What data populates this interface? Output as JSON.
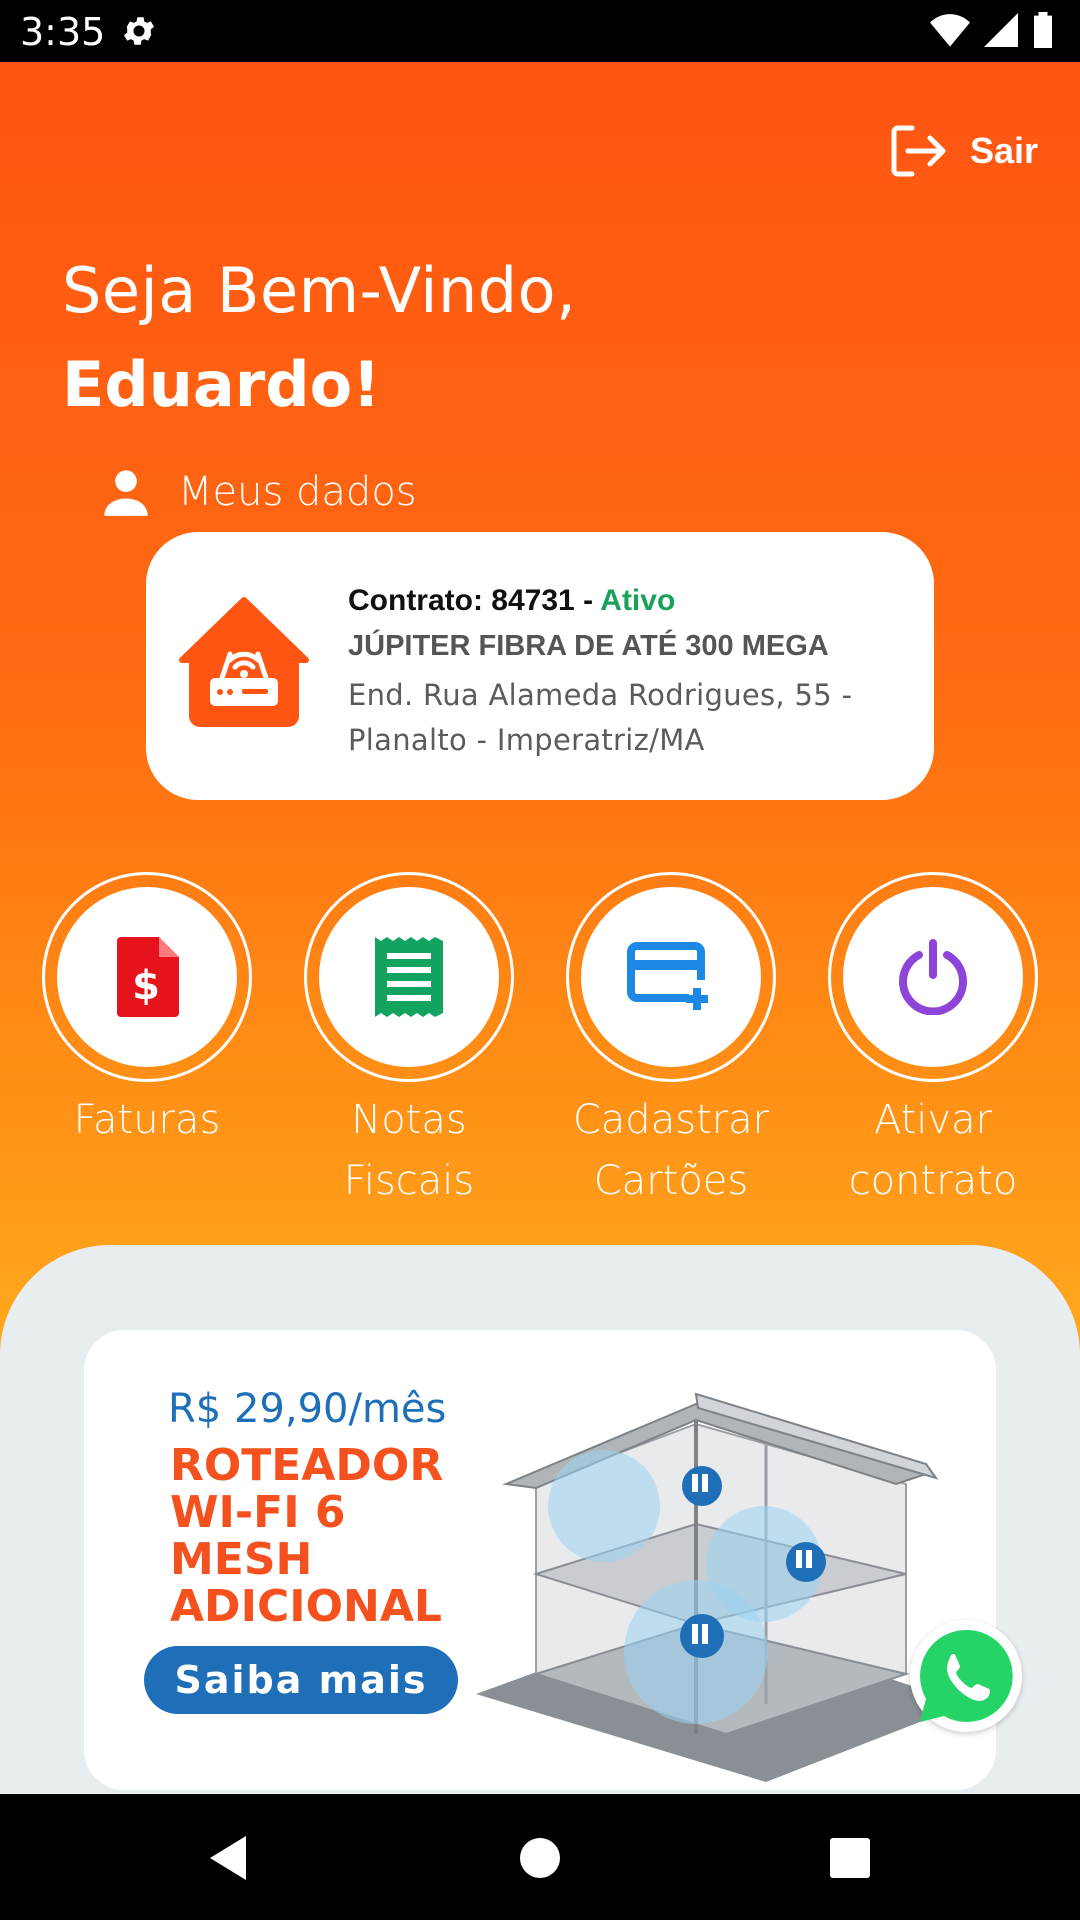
{
  "status_bar": {
    "time": "3:35",
    "icons": [
      "gear-icon",
      "wifi-icon",
      "signal-icon",
      "battery-icon"
    ]
  },
  "header": {
    "logout_label": "Sair",
    "logout_icon": "logout-icon"
  },
  "greeting": {
    "line1": "Seja Bem-Vindo,",
    "name": "Eduardo!"
  },
  "profile_link": {
    "label": "Meus dados",
    "icon": "person-icon"
  },
  "contract": {
    "prefix": "Contrato: 84731 - ",
    "status": "Ativo",
    "plan": "JÚPITER FIBRA DE ATÉ 300 MEGA",
    "address": "End. Rua Alameda Rodrigues, 55 - Planalto - Imperatriz/MA",
    "icon": "house-router-icon"
  },
  "actions": [
    {
      "line1": "Faturas",
      "line2": "",
      "icon": "invoice-icon",
      "color": "#e6131c"
    },
    {
      "line1": "Notas",
      "line2": "Fiscais",
      "icon": "receipt-icon",
      "color": "#13a360"
    },
    {
      "line1": "Cadastrar",
      "line2": "Cartões",
      "icon": "add-card-icon",
      "color": "#1e88e5"
    },
    {
      "line1": "Ativar",
      "line2": "contrato",
      "icon": "power-icon",
      "color": "#8e44d9"
    }
  ],
  "promo": {
    "price": "R$ 29,90/mês",
    "title": "ROTEADOR WI-FI 6 MESH ADICIONAL",
    "button": "Saiba mais"
  },
  "colors": {
    "brand_orange": "#ff5512",
    "promo_blue": "#1e6fb8",
    "status_green": "#1aa15a"
  }
}
